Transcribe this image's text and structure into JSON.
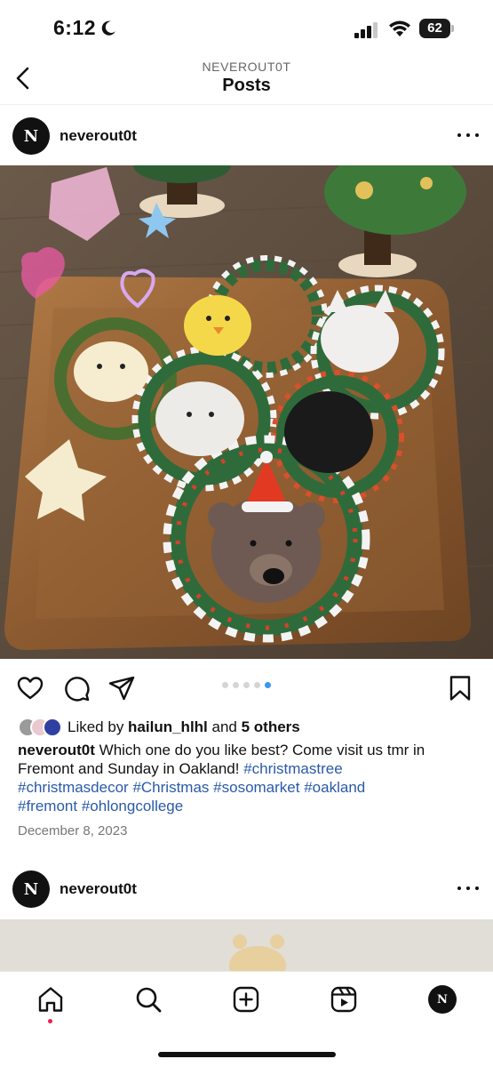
{
  "status_bar": {
    "time": "6:12",
    "battery": "62"
  },
  "header": {
    "username": "NEVEROUT0T",
    "title": "Posts"
  },
  "post": {
    "avatar_letter": "N",
    "username": "neverout0t",
    "image_count": 5,
    "active_image": 5,
    "liked_by_prefix": "Liked by ",
    "liked_by_user": "hailun_hlhl",
    "liked_by_and": " and ",
    "liked_by_others": "5 others",
    "caption_user": "neverout0t",
    "caption_text": " Which one do you like best? Come visit us tmr in Fremont and Sunday in Oakland! ",
    "hashtags": [
      "#christmastree",
      "#christmasdecor",
      "#Christmas",
      "#sosomarket",
      "#oakland",
      "#fremont",
      "#ohlongcollege"
    ],
    "date": "December 8, 2023"
  },
  "next_post": {
    "avatar_letter": "N",
    "username": "neverout0t"
  },
  "tabbar": {
    "items": [
      "home-icon",
      "search-icon",
      "create-icon",
      "reels-icon",
      "profile-avatar"
    ],
    "profile_letter": "N"
  },
  "colors": {
    "accent": "#3897f0",
    "hashtag": "#2a5aa8",
    "notification": "#ee1d52"
  }
}
